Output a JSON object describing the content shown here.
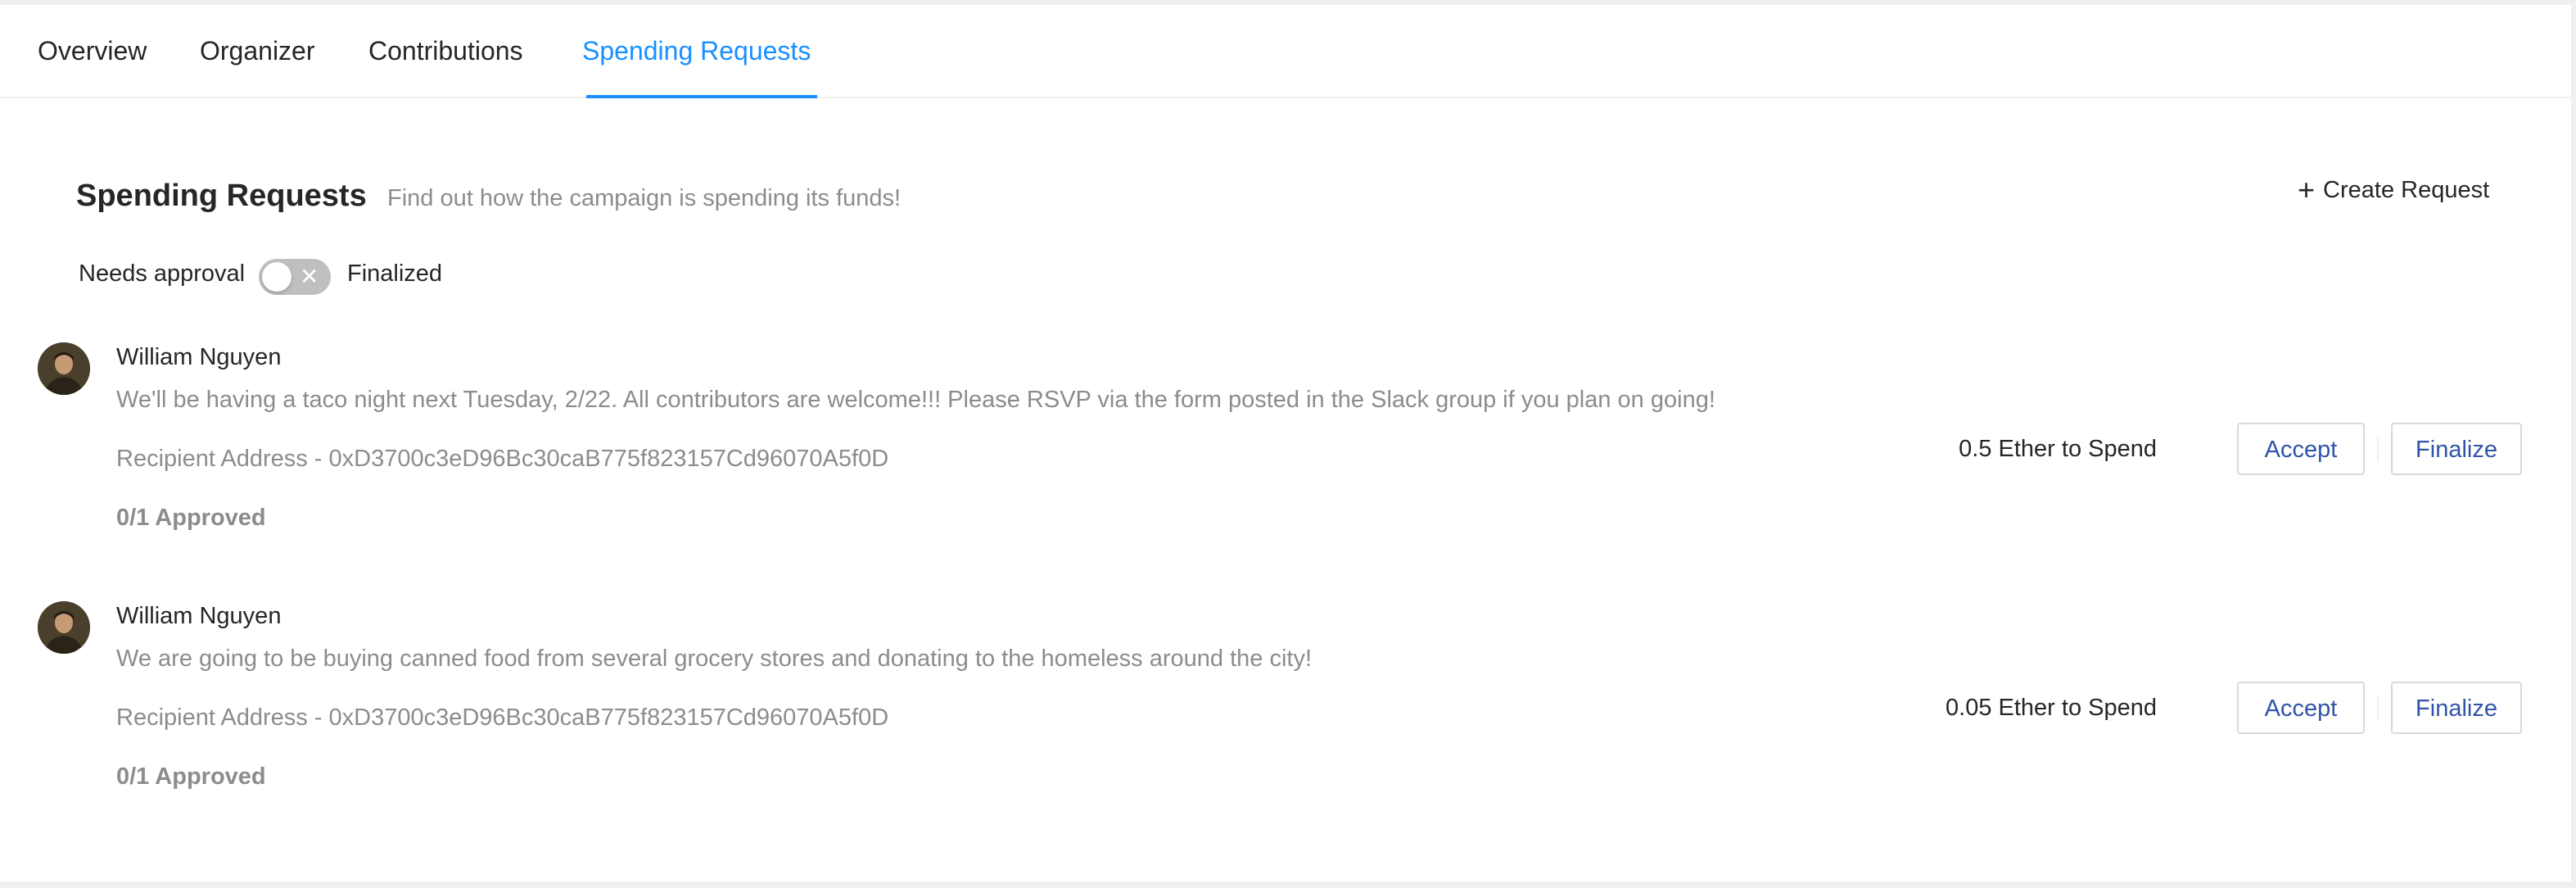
{
  "tabs": [
    {
      "label": "Overview"
    },
    {
      "label": "Organizer"
    },
    {
      "label": "Contributions"
    },
    {
      "label": "Spending Requests",
      "active": true
    }
  ],
  "header": {
    "title": "Spending Requests",
    "subtitle": "Find out how the campaign is spending its funds!",
    "create_label": "Create Request",
    "create_icon": "plus-icon"
  },
  "filter": {
    "left_label": "Needs approval",
    "right_label": "Finalized",
    "toggle_on": false,
    "toggle_icon": "close-icon"
  },
  "requests": [
    {
      "author": "William Nguyen",
      "description": "We'll be having a taco night next Tuesday, 2/22. All contributors are welcome!!! Please RSVP via the form posted in the Slack group if you plan on going!",
      "recipient": "Recipient Address - 0xD3700c3eD96Bc30caB775f823157Cd96070A5f0D",
      "approved": "0/1 Approved",
      "amount": "0.5 Ether to Spend",
      "accept_label": "Accept",
      "finalize_label": "Finalize"
    },
    {
      "author": "William Nguyen",
      "description": "We are going to be buying canned food from several grocery stores and donating to the homeless around the city!",
      "recipient": "Recipient Address - 0xD3700c3eD96Bc30caB775f823157Cd96070A5f0D",
      "approved": "0/1 Approved",
      "amount": "0.05 Ether to Spend",
      "accept_label": "Accept",
      "finalize_label": "Finalize"
    }
  ],
  "colors": {
    "accent": "#1890ff",
    "button_text": "#2f54a8",
    "muted_text": "#8c8c8c",
    "switch_off": "#bfbfbf"
  }
}
